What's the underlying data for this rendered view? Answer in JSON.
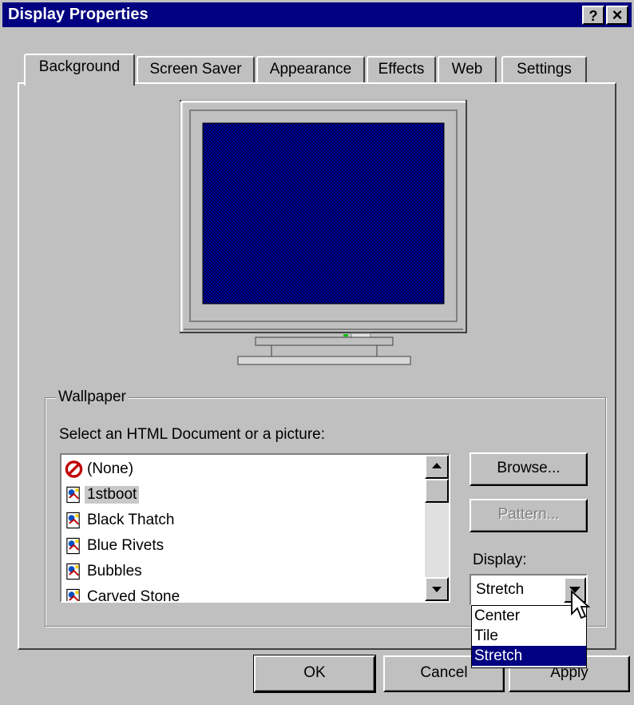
{
  "window": {
    "title": "Display Properties",
    "help_button": "?",
    "close_button": "×"
  },
  "tabs": [
    {
      "label": "Background",
      "active": true
    },
    {
      "label": "Screen Saver"
    },
    {
      "label": "Appearance"
    },
    {
      "label": "Effects"
    },
    {
      "label": "Web"
    },
    {
      "label": "Settings"
    }
  ],
  "wallpaper": {
    "group_label": "Wallpaper",
    "select_label": "Select an HTML Document or a picture:",
    "items": [
      {
        "label": "(None)",
        "icon": "none-icon"
      },
      {
        "label": "1stboot",
        "icon": "html-document-icon",
        "selected": true
      },
      {
        "label": "Black Thatch",
        "icon": "html-document-icon"
      },
      {
        "label": "Blue Rivets",
        "icon": "html-document-icon"
      },
      {
        "label": "Bubbles",
        "icon": "html-document-icon"
      },
      {
        "label": "Carved Stone",
        "icon": "html-document-icon"
      }
    ],
    "browse_button": "Browse...",
    "pattern_button": "Pattern...",
    "display_label": "Display:",
    "display_value": "Stretch",
    "display_options": [
      "Center",
      "Tile",
      "Stretch"
    ]
  },
  "footer": {
    "ok_button": "OK",
    "cancel_button": "Cancel",
    "apply_button": "Apply"
  },
  "colors": {
    "titlebar": "#000080",
    "face": "#c0c0c0",
    "preview_desktop": "#0000a8",
    "selection": "#000080"
  }
}
